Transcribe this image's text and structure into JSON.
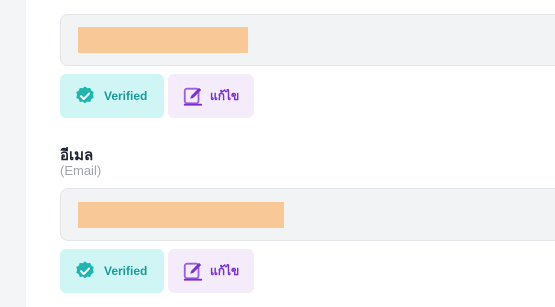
{
  "colors": {
    "verified_bg": "#cff6f4",
    "verified_fg": "#1a9a9a",
    "edit_bg": "#f4ecfb",
    "edit_fg": "#7a2fd3",
    "field_bg": "#f2f3f5",
    "redaction": "#f8c896"
  },
  "field_1": {
    "verified": {
      "label": "Verified",
      "icon": "verified-badge-icon"
    },
    "edit": {
      "label": "แก้ไข",
      "icon": "edit-pencil-icon"
    }
  },
  "email": {
    "label": "อีเมล",
    "sublabel": "(Email)",
    "verified": {
      "label": "Verified",
      "icon": "verified-badge-icon"
    },
    "edit": {
      "label": "แก้ไข",
      "icon": "edit-pencil-icon"
    }
  }
}
